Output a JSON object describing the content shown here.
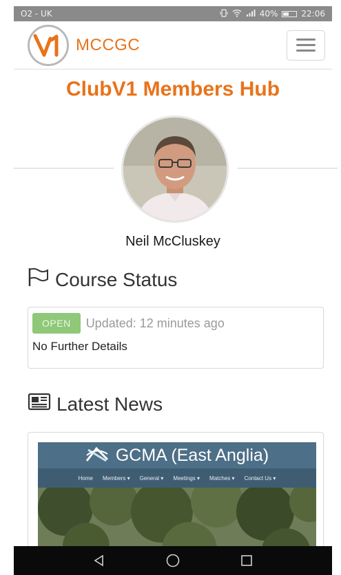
{
  "status_bar": {
    "carrier": "O2 - UK",
    "battery_percent": "40%",
    "time": "22:06",
    "icons": [
      "vibrate-icon",
      "wifi-icon",
      "signal-icon",
      "battery-icon"
    ]
  },
  "navbar": {
    "logo_letter": "V1",
    "brand": "MCCGC",
    "menu_icon": "hamburger-icon"
  },
  "hub_title": "ClubV1 Members Hub",
  "member": {
    "name": "Neil McCluskey"
  },
  "course_status": {
    "heading": "Course Status",
    "icon": "flag-icon",
    "badge": "OPEN",
    "updated": "Updated: 12 minutes ago",
    "details": "No Further Details"
  },
  "latest_news": {
    "heading": "Latest News",
    "icon": "newspaper-icon",
    "card": {
      "site_title": "GCMA (East Anglia)",
      "nav_items": [
        "Home",
        "Members",
        "General",
        "Meetings",
        "Matches",
        "Contact Us"
      ]
    }
  },
  "colors": {
    "brand_orange": "#e8731a",
    "open_green": "#8fc878",
    "status_bar": "#8a8a8a"
  }
}
